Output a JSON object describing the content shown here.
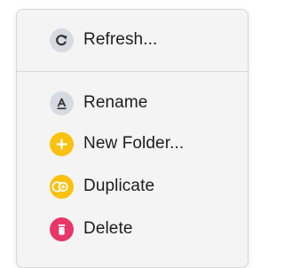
{
  "menu": {
    "items": [
      {
        "label": "Refresh...",
        "icon": "refresh-icon",
        "icon_bg": "#d6dbe2"
      },
      {
        "label": "Rename",
        "icon": "rename-icon",
        "icon_bg": "#d6dbe2"
      },
      {
        "label": "New Folder...",
        "icon": "plus-icon",
        "icon_bg": "#fbc10c"
      },
      {
        "label": "Duplicate",
        "icon": "duplicate-icon",
        "icon_bg": "#fbc10c"
      },
      {
        "label": "Delete",
        "icon": "trash-icon",
        "icon_bg": "#e8366a"
      }
    ]
  }
}
